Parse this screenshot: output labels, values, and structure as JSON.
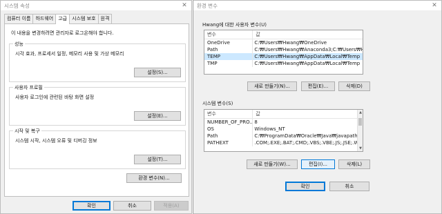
{
  "sys_props": {
    "title": "시스템 속성",
    "tabs": [
      "컴퓨터 이름",
      "하드웨어",
      "고급",
      "시스템 보호",
      "원격"
    ],
    "notice": "이 내용을 변경하려면 관리자로 로그온해야 합니다.",
    "groups": {
      "performance": {
        "legend": "성능",
        "desc": "시각 효과, 프로세서 일정, 메모리 사용 및 가상 메모리",
        "button": "설정(S)..."
      },
      "profile": {
        "legend": "사용자 프로필",
        "desc": "사용자 로그인에 관련된 바탕 화면 설정",
        "button": "설정(E)..."
      },
      "startup": {
        "legend": "시작 및 복구",
        "desc": "시스템 시작, 시스템 오류 및 디버깅 정보",
        "button": "설정(T)..."
      }
    },
    "env_button": "환경 변수(N)...",
    "ok": "확인",
    "cancel": "취소",
    "apply": "적용(A)"
  },
  "env_vars": {
    "title": "환경 변수",
    "user_section": "Hwang에 대한 사용자 변수(U)",
    "columns": {
      "name": "변수",
      "value": "값"
    },
    "user_vars": [
      {
        "name": "OneDrive",
        "value": "C:₩Users₩Hwang₩OneDrive"
      },
      {
        "name": "Path",
        "value": "C:₩Users₩Hwang₩Anaconda3;C:₩Users₩H..."
      },
      {
        "name": "TEMP",
        "value": "C:₩Users₩Hwang₩AppData₩Local₩Temp"
      },
      {
        "name": "TMP",
        "value": "C:₩Users₩Hwang₩AppData₩Local₩Temp"
      }
    ],
    "user_buttons": {
      "new": "새로 만들기(N)...",
      "edit": "편집(E)...",
      "delete": "삭제(D)"
    },
    "system_section": "시스템 변수(S)",
    "system_vars": [
      {
        "name": "NUMBER_OF_PRO...",
        "value": "8"
      },
      {
        "name": "OS",
        "value": "Windows_NT"
      },
      {
        "name": "Path",
        "value": "C:₩ProgramData₩Oracle₩Java₩javapath;C:..."
      },
      {
        "name": "PATHEXT",
        "value": ".COM;.EXE;.BAT;.CMD;.VBS;.VBE;.JS;.JSE;.W..."
      }
    ],
    "system_buttons": {
      "new": "새로 만들기(W)...",
      "edit": "편집(I)...",
      "delete": "삭제(L)"
    },
    "ok": "확인",
    "cancel": "취소"
  }
}
